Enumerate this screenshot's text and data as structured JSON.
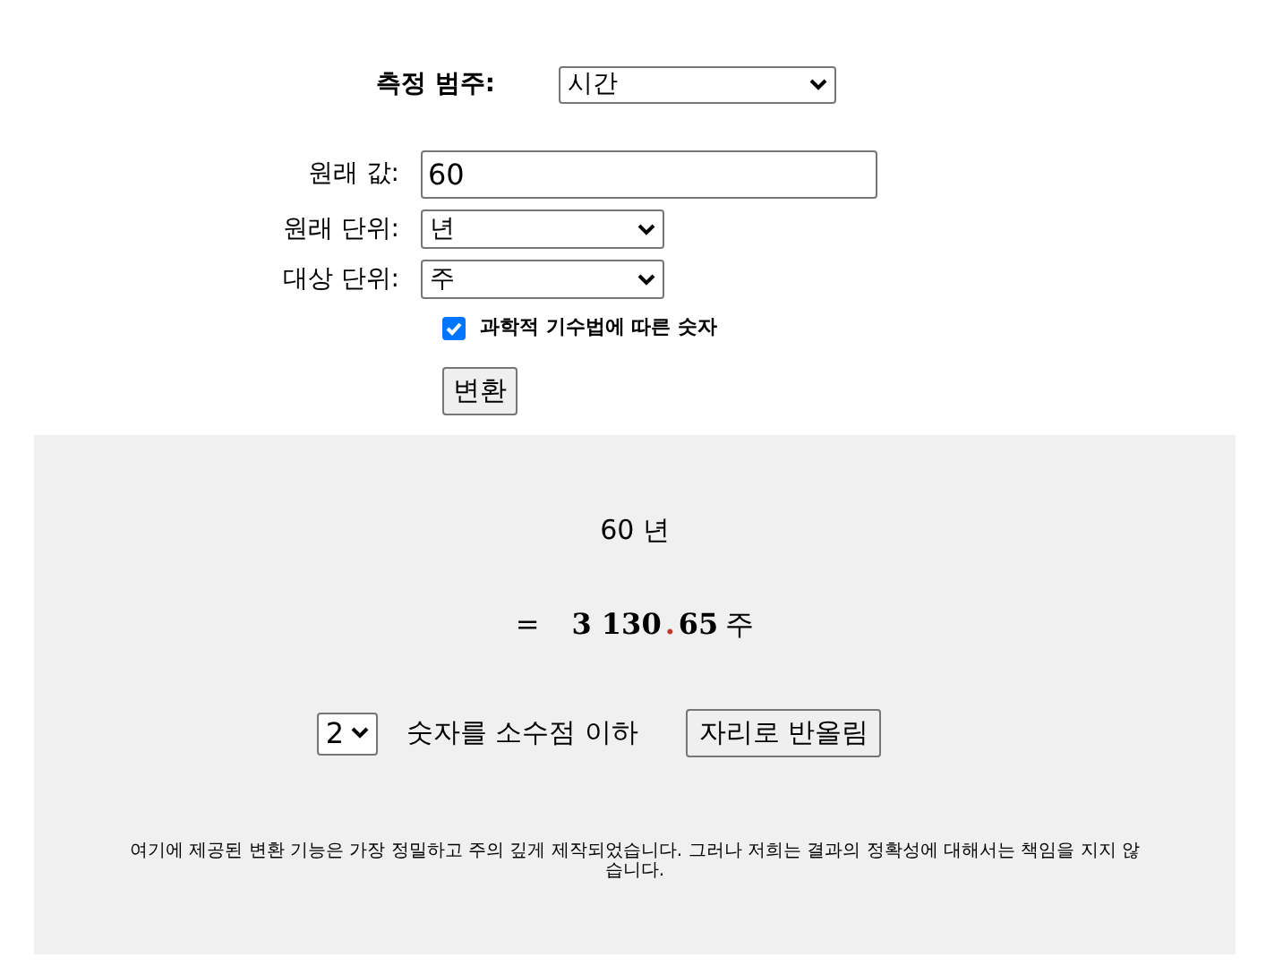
{
  "category": {
    "label": "측정 범주:",
    "value": "시간"
  },
  "fields": [
    {
      "kind": "input",
      "label": "원래 값:",
      "value": "60"
    },
    {
      "kind": "select",
      "label": "원래 단위:",
      "value": "년"
    },
    {
      "kind": "select",
      "label": "대상 단위:",
      "value": "주"
    }
  ],
  "scientific": {
    "label": "과학적 기수법에 따른 숫자",
    "checked": true
  },
  "convert_button": "변환",
  "result": {
    "source": "60 년",
    "equals": "=",
    "integer": "3 130",
    "decimal_mark": ".",
    "fraction": "65",
    "unit": "주"
  },
  "rounding": {
    "digits": "2",
    "text": "숫자를 소수점 이하",
    "button": "자리로 반올림"
  },
  "disclaimer": "여기에 제공된 변환 기능은 가장 정밀하고 주의 깊게 제작되었습니다. 그러나 저희는 결과의 정확성에 대해서는 책임을 지지 않습니다."
}
